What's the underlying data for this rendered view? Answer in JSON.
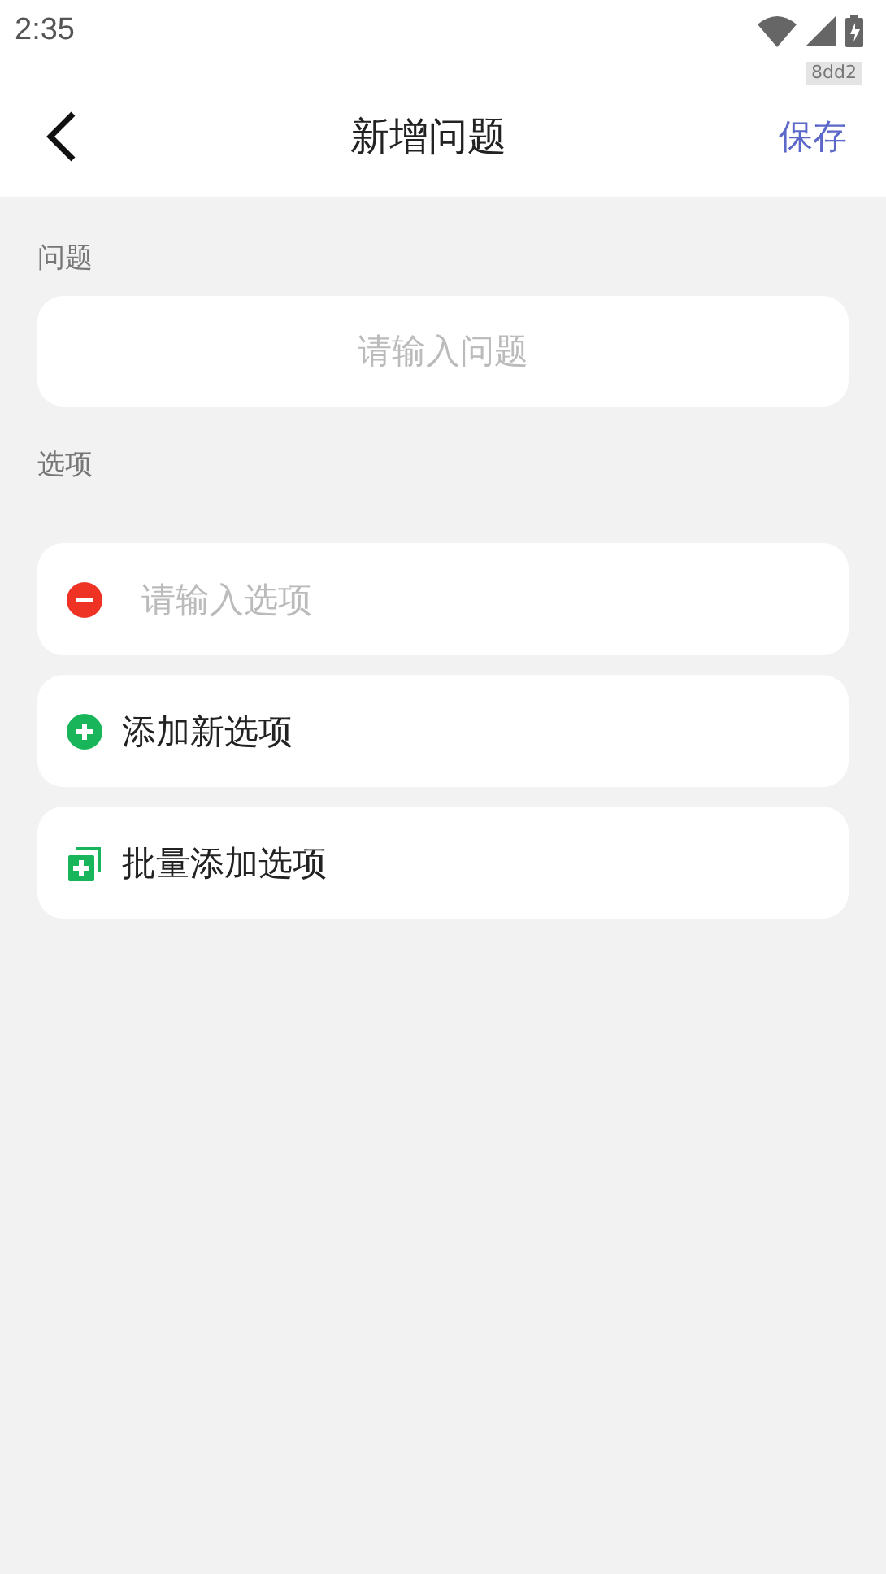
{
  "status_bar": {
    "time": "2:35",
    "tag": "8dd2"
  },
  "header": {
    "title": "新增问题",
    "action": "保存"
  },
  "question": {
    "label": "问题",
    "placeholder": "请输入问题"
  },
  "options": {
    "label": "选项",
    "items": [
      {
        "placeholder": "请输入选项"
      }
    ]
  },
  "actions": [
    {
      "kind": "add",
      "label": "添加新选项"
    },
    {
      "kind": "batch",
      "label": "批量添加选项"
    }
  ]
}
